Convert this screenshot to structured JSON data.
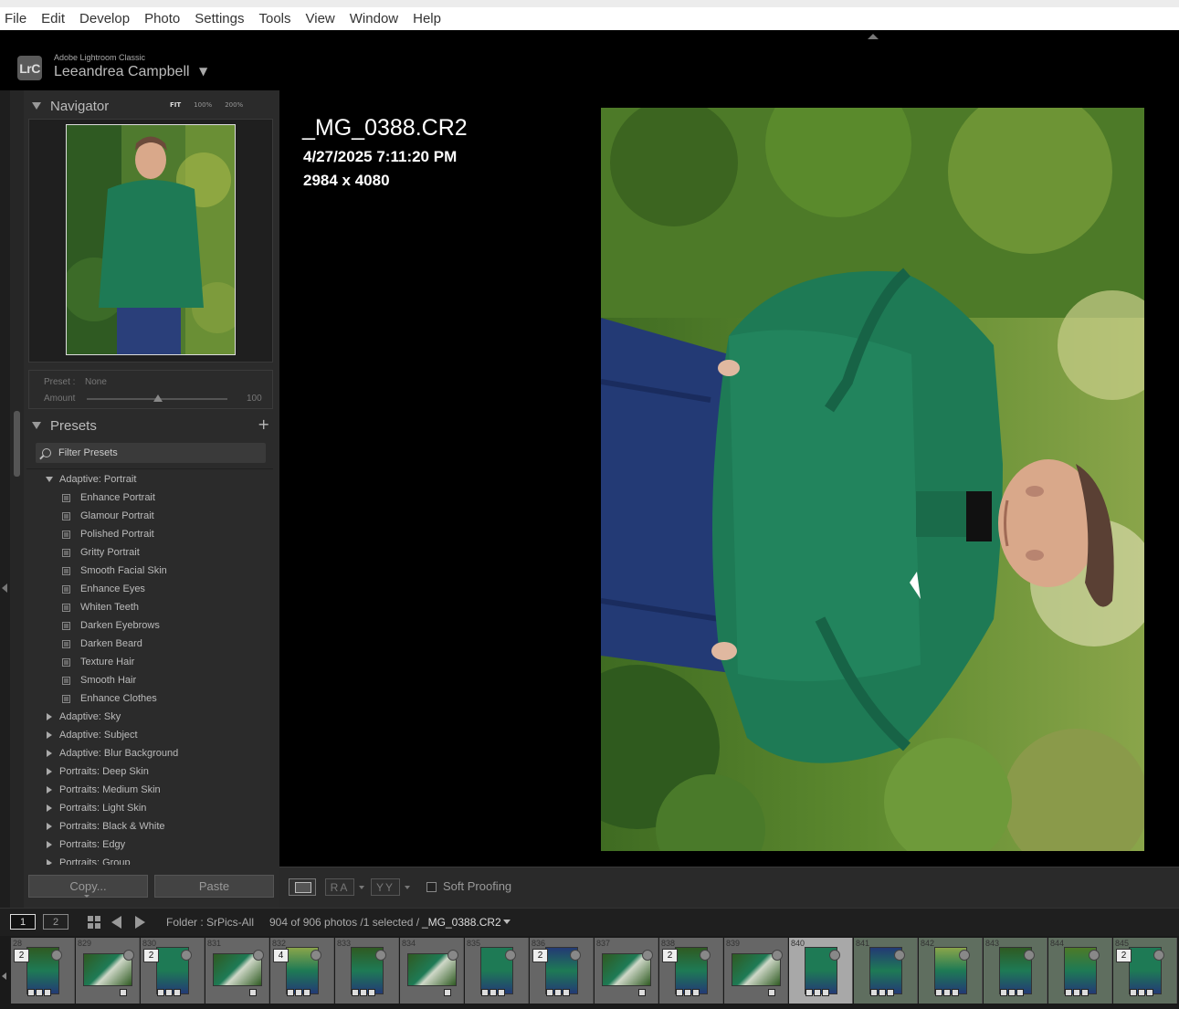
{
  "menubar": {
    "items": [
      "File",
      "Edit",
      "Develop",
      "Photo",
      "Settings",
      "Tools",
      "View",
      "Window",
      "Help"
    ]
  },
  "identity": {
    "badge": "LrC",
    "app_name": "Adobe Lightroom Classic",
    "user_name": "Leeandrea Campbell",
    "dropdown_glyph": "▼"
  },
  "navigator": {
    "title": "Navigator",
    "zoom_options": [
      "FIT",
      "100%",
      "200%"
    ],
    "selected_zoom": "FIT"
  },
  "preset_amount": {
    "preset_label": "Preset :",
    "preset_value": "None",
    "amount_label": "Amount",
    "amount_value": "100"
  },
  "presets": {
    "title": "Presets",
    "add_glyph": "+",
    "filter_placeholder": "Filter Presets",
    "open_group": "Adaptive: Portrait",
    "open_group_items": [
      "Enhance Portrait",
      "Glamour Portrait",
      "Polished Portrait",
      "Gritty Portrait",
      "Smooth Facial Skin",
      "Enhance Eyes",
      "Whiten Teeth",
      "Darken Eyebrows",
      "Darken Beard",
      "Texture Hair",
      "Smooth Hair",
      "Enhance Clothes"
    ],
    "closed_groups": [
      "Adaptive: Sky",
      "Adaptive: Subject",
      "Adaptive: Blur Background",
      "Portraits: Deep Skin",
      "Portraits: Medium Skin",
      "Portraits: Light Skin",
      "Portraits: Black & White",
      "Portraits: Edgy",
      "Portraits: Group"
    ]
  },
  "buttons": {
    "copy": "Copy...",
    "paste": "Paste"
  },
  "photo_info": {
    "filename": "_MG_0388.CR2",
    "datetime": "4/27/2025 7:11:20 PM",
    "dimensions": "2984 x 4080"
  },
  "toolbar": {
    "before_after_label": "RA",
    "yy_label": "YY",
    "soft_proofing": "Soft Proofing",
    "soft_proofing_checked": false
  },
  "filmbar": {
    "screen1": "1",
    "screen2": "2",
    "folder": "Folder : SrPics-All",
    "count": "904 of 906 photos /1 selected /",
    "selected_file": "_MG_0388.CR2"
  },
  "filmstrip": {
    "cells": [
      {
        "num": "28",
        "stack": "2",
        "style": "vertical",
        "state": "normal"
      },
      {
        "num": "829",
        "stack": "",
        "style": "landscape",
        "state": "normal"
      },
      {
        "num": "830",
        "stack": "2",
        "style": "vertical",
        "state": "normal"
      },
      {
        "num": "831",
        "stack": "",
        "style": "landscape",
        "state": "normal"
      },
      {
        "num": "832",
        "stack": "4",
        "style": "vertical",
        "state": "normal"
      },
      {
        "num": "833",
        "stack": "",
        "style": "vertical",
        "state": "normal"
      },
      {
        "num": "834",
        "stack": "",
        "style": "landscape",
        "state": "normal"
      },
      {
        "num": "835",
        "stack": "",
        "style": "vertical",
        "state": "normal"
      },
      {
        "num": "836",
        "stack": "2",
        "style": "vertical",
        "state": "normal"
      },
      {
        "num": "837",
        "stack": "",
        "style": "landscape",
        "state": "normal"
      },
      {
        "num": "838",
        "stack": "2",
        "style": "vertical",
        "state": "normal"
      },
      {
        "num": "839",
        "stack": "",
        "style": "landscape",
        "state": "normal"
      },
      {
        "num": "840",
        "stack": "",
        "style": "vertical",
        "state": "selected"
      },
      {
        "num": "841",
        "stack": "",
        "style": "vertical",
        "state": "green"
      },
      {
        "num": "842",
        "stack": "",
        "style": "vertical",
        "state": "green"
      },
      {
        "num": "843",
        "stack": "",
        "style": "vertical",
        "state": "green"
      },
      {
        "num": "844",
        "stack": "",
        "style": "vertical",
        "state": "green"
      },
      {
        "num": "845",
        "stack": "2",
        "style": "vertical",
        "state": "green"
      }
    ]
  },
  "colors": {
    "panel_bg": "#2b2b2b",
    "main_bg": "#000000",
    "hoodie_green": "#1e7a55",
    "jeans_blue": "#233a75",
    "foliage": "#5d8a2e"
  }
}
